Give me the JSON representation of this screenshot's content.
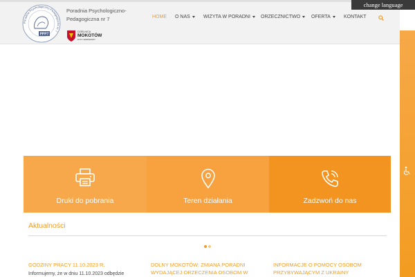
{
  "header": {
    "brand_name": "Poradnia Psychologiczno-Pedagogiczna nr 7",
    "logo_ring_text": "Poradnia Psychologiczno-Pedagogiczna nr 7",
    "logo_badge": "PPP7",
    "district": {
      "small": "DZIELNICA",
      "name": "MOKOTÓW",
      "sub": "M.ST. WARSZAWY"
    },
    "nav": [
      {
        "label": "HOME",
        "active": true,
        "dropdown": false
      },
      {
        "label": "O NAS",
        "active": false,
        "dropdown": true
      },
      {
        "label": "WIZYTA W PORADNI",
        "active": false,
        "dropdown": true
      },
      {
        "label": "ORZECZNICTWO",
        "active": false,
        "dropdown": true
      },
      {
        "label": "OFERTA",
        "active": false,
        "dropdown": true
      },
      {
        "label": "KONTAKT",
        "active": false,
        "dropdown": false
      }
    ],
    "search_icon": "search-icon",
    "language_button": "change language"
  },
  "accessibility": {
    "icon": "wheelchair-icon"
  },
  "features": [
    {
      "label": "Druki do pobrania",
      "icon": "printer-icon"
    },
    {
      "label": "Teren działania",
      "icon": "map-pin-icon"
    },
    {
      "label": "Zadzwoń do nas",
      "icon": "phone-icon"
    }
  ],
  "news": {
    "title": "Aktualności",
    "items": [
      {
        "title": "GODZINY PRACY 11.10.2023 R.",
        "text": "Informujemy, że w dniu 11.10.2023 odbędzie się"
      },
      {
        "title": "DOLNY MOKOTÓW: ZMIANA PORADNI WYDAJĄCEJ ORZECZENIA OSOBOM W"
      },
      {
        "title": "INFORMACJE O POMOCY OSOBOM PRZYBYWAJĄCYM Z UKRAINY"
      }
    ]
  },
  "colors": {
    "accent": "#f39c21",
    "box1": "#f7a84b",
    "box2": "#f7a13f",
    "box3": "#f39320",
    "lang_bg": "#3a3a3a"
  }
}
